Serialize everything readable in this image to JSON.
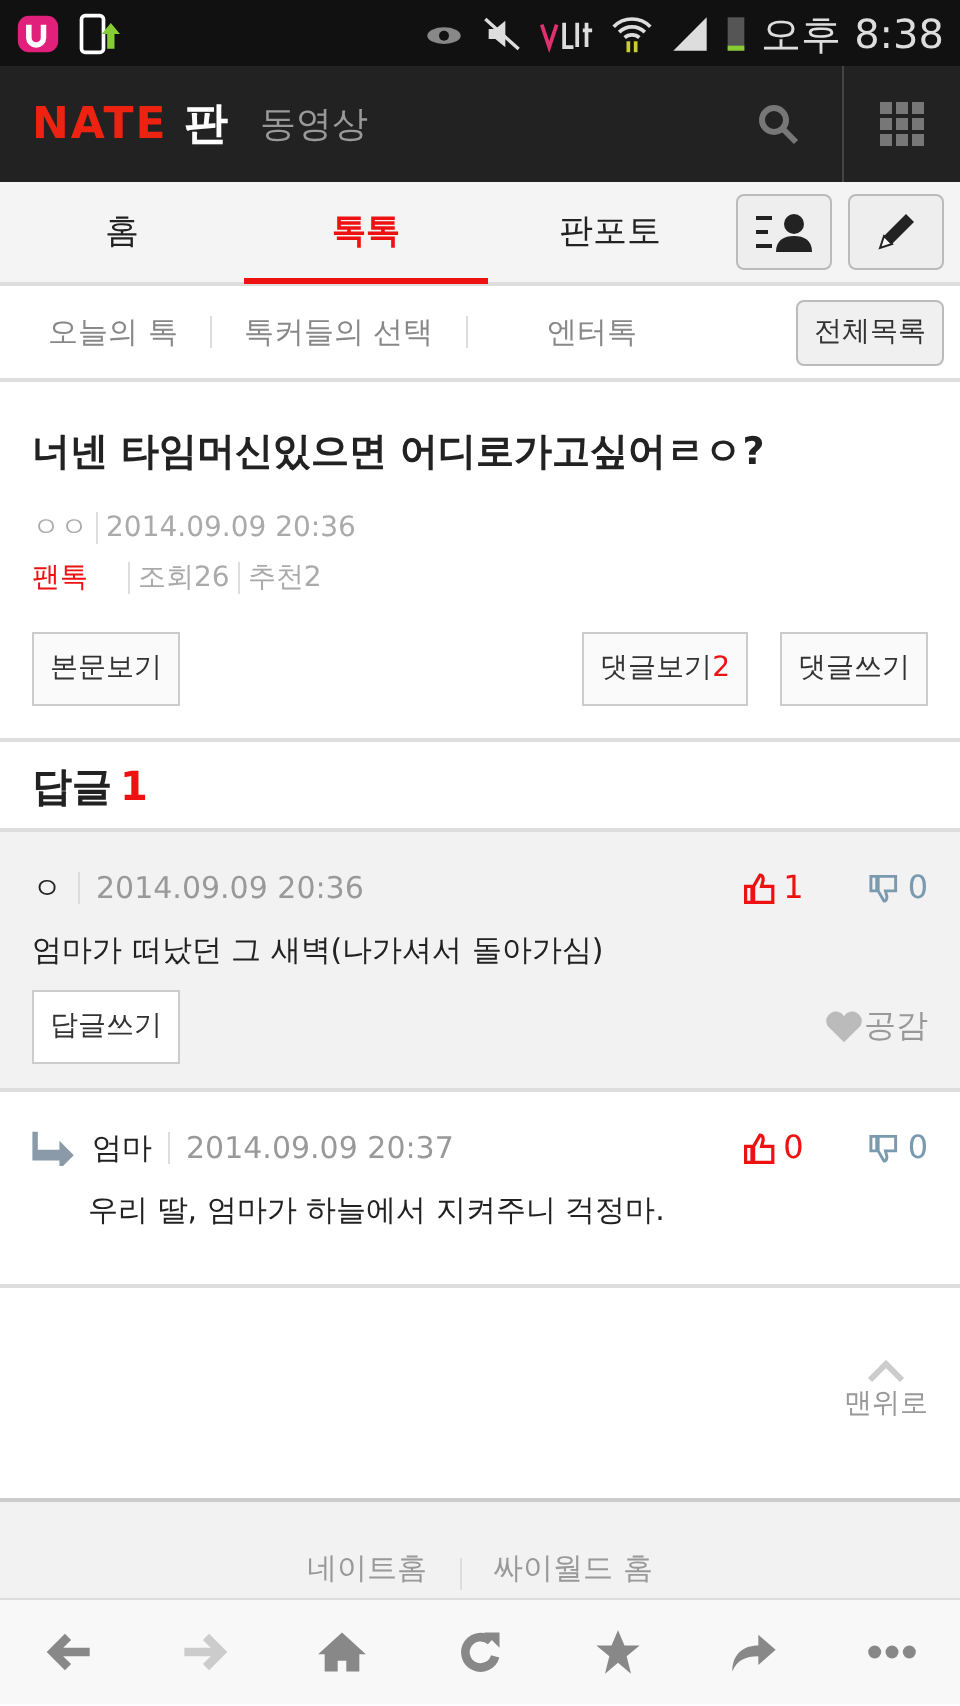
{
  "status_bar": {
    "time": "오후 8:38"
  },
  "header": {
    "logo": "NATE",
    "section": "판",
    "link": "동영상"
  },
  "tabs": [
    {
      "label": "홈",
      "selected": false
    },
    {
      "label": "톡톡",
      "selected": true
    },
    {
      "label": "판포토",
      "selected": false
    }
  ],
  "subnav": {
    "items": [
      "오늘의 톡",
      "톡커들의 선택",
      "엔터톡"
    ],
    "all_button": "전체목록"
  },
  "post": {
    "title": "너넨 타임머신있으면 어디로가고싶어ㄹㅇ?",
    "author": "ㅇㅇ",
    "date": "2014.09.09 20:36",
    "category": "팬톡",
    "views": "조회26",
    "recommends": "추천2",
    "view_body": "본문보기",
    "comments_label": "댓글보기",
    "comments_count": "2",
    "write_comment": "댓글쓰기"
  },
  "replies_heading": {
    "label": "답글",
    "count": "1"
  },
  "comments": [
    {
      "kind": "comment",
      "author": "ㅇ",
      "date": "2014.09.09 20:36",
      "likes": "1",
      "dislikes": "0",
      "text": "엄마가 떠났던 그 새벽(나가셔서 돌아가심)",
      "reply_button": "답글쓰기",
      "empathy": "공감"
    },
    {
      "kind": "reply",
      "author": "엄마",
      "date": "2014.09.09 20:37",
      "likes": "0",
      "dislikes": "0",
      "text": "우리 딸, 엄마가 하늘에서 지켜주니 걱정마."
    }
  ],
  "top_button": "맨위로",
  "footer_links": [
    "네이트홈",
    "싸이월드 홈"
  ],
  "toolbar": [
    {
      "kind": "back",
      "disabled": false
    },
    {
      "kind": "forward",
      "disabled": true
    },
    {
      "kind": "home",
      "disabled": false
    },
    {
      "kind": "reload",
      "disabled": false
    },
    {
      "kind": "bookmark",
      "disabled": false
    },
    {
      "kind": "share",
      "disabled": false
    },
    {
      "kind": "more",
      "disabled": false
    }
  ]
}
